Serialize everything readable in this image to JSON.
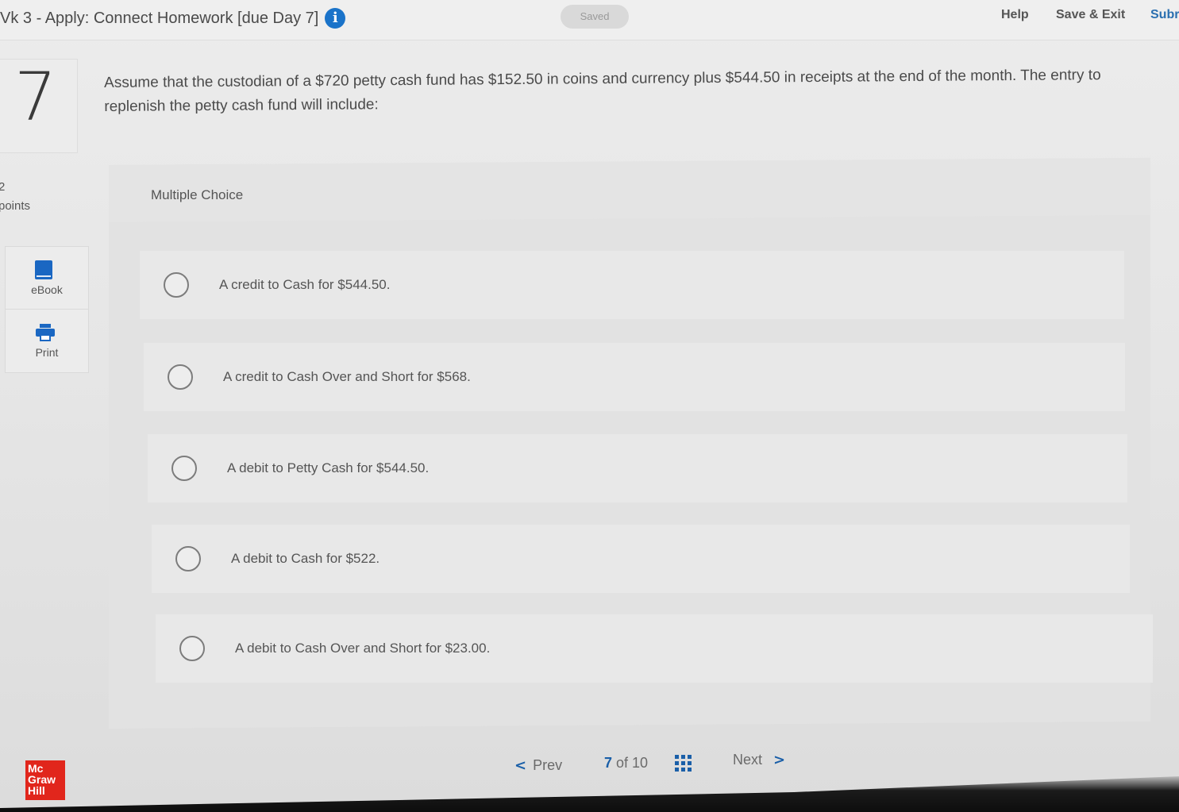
{
  "header": {
    "title": "Vk 3 - Apply: Connect Homework [due Day 7]",
    "info_icon": "info-icon",
    "saved": "Saved",
    "links": {
      "help": "Help",
      "save_exit": "Save & Exit",
      "submit": "Subr"
    }
  },
  "question": {
    "number": "7",
    "points_value": "2",
    "points_label": "points",
    "text": "Assume that the custodian of a $720 petty cash fund has $152.50 in coins and currency plus $544.50 in receipts at the end of the month. The entry to replenish the petty cash fund will include:"
  },
  "tools": {
    "ebook": {
      "label": "eBook",
      "icon": "book-icon"
    },
    "print": {
      "label": "Print",
      "icon": "printer-icon"
    }
  },
  "multiple_choice": {
    "title": "Multiple Choice",
    "options": [
      "A credit to Cash for $544.50.",
      "A credit to Cash Over and Short for $568.",
      "A debit to Petty Cash for $544.50.",
      "A debit to Cash for $522.",
      "A debit to Cash Over and Short for $23.00."
    ]
  },
  "footer": {
    "logo": [
      "Mc",
      "Graw",
      "Hill"
    ],
    "prev": "Prev",
    "current": "7",
    "of": "of 10",
    "next": "Next"
  },
  "colors": {
    "accent": "#1a5fa8",
    "logo": "#e1261c"
  }
}
